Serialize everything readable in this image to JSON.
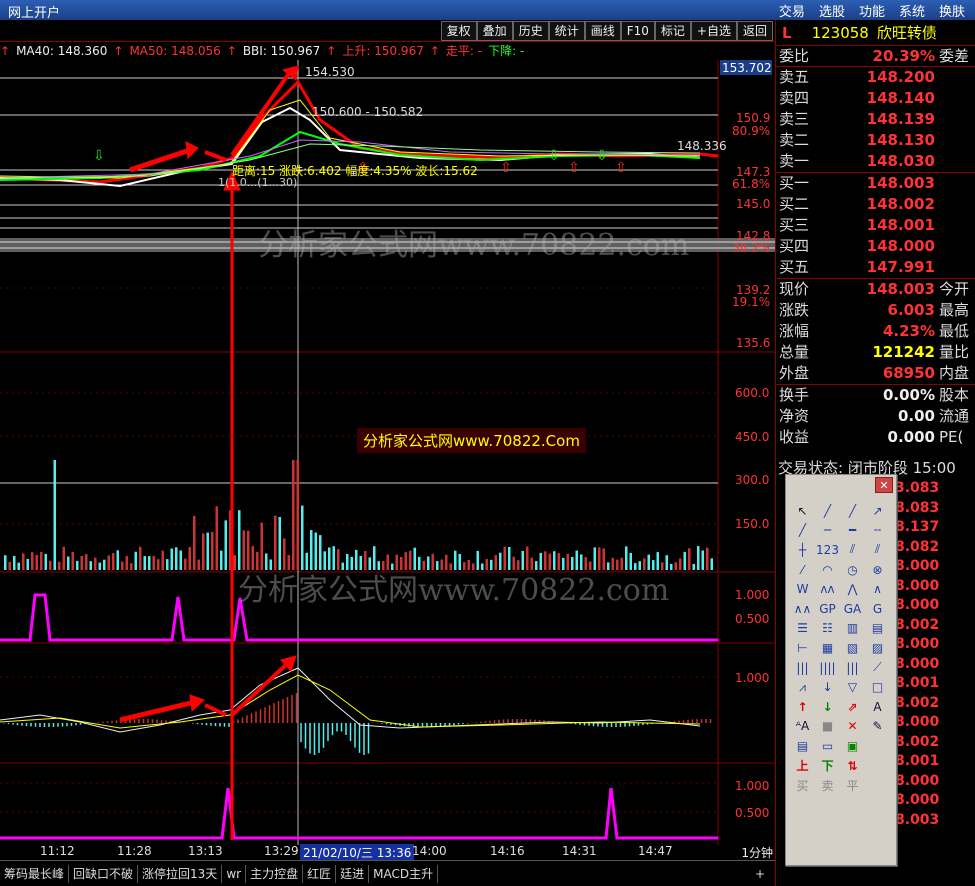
{
  "topbar": {
    "title": "网上开户",
    "menu": [
      "交易",
      "选股",
      "功能",
      "系统",
      "换肤"
    ]
  },
  "toolbar": {
    "buttons": [
      "复权",
      "叠加",
      "历史",
      "统计",
      "画线",
      "F10",
      "标记",
      "+自选",
      "返回"
    ]
  },
  "info": {
    "ma40": "MA40: 148.360",
    "ma50": "MA50: 148.056",
    "bbi": "BBI: 150.967",
    "up": "上升: 150.967",
    "flat": "走平: -",
    "down": "下降: -"
  },
  "price_axis": {
    "current_badge": "153.702",
    "labels": [
      {
        "text": "150.9"
      },
      {
        "text": "80.9%"
      },
      {
        "text": "147.3"
      },
      {
        "text": "61.8%"
      },
      {
        "text": "145.0"
      },
      {
        "text": "142.8"
      },
      {
        "text": "38.2%"
      },
      {
        "text": "139.2"
      },
      {
        "text": "19.1%"
      },
      {
        "text": "135.6"
      }
    ],
    "volume_labels": [
      "600.0",
      "450.0",
      "300.0",
      "150.0"
    ],
    "ind1_labels": [
      "1.000",
      "0.500"
    ],
    "ind2_labels": [
      "1.000"
    ],
    "ind3_labels": [
      "1.000",
      "0.500"
    ]
  },
  "annotations": {
    "high": "154.530",
    "range": "150.600 - 150.582",
    "last": "148.336",
    "measure": "距离:15 涨跌:6.402 幅度:4.35% 波长:15.62",
    "low_label": "1(1.0...(1...30)"
  },
  "watermarks": {
    "badge": "分析家公式网www.70822.Com",
    "big": "分析家公式网www.70822.com"
  },
  "quote": {
    "indicator": "L",
    "code": "123058",
    "name": "欣旺转债",
    "weibi": {
      "k": "委比",
      "v": "20.39%",
      "x": "委差"
    },
    "asks": [
      {
        "k": "卖五",
        "v": "148.200"
      },
      {
        "k": "卖四",
        "v": "148.140"
      },
      {
        "k": "卖三",
        "v": "148.139"
      },
      {
        "k": "卖二",
        "v": "148.130"
      },
      {
        "k": "卖一",
        "v": "148.030"
      }
    ],
    "bids": [
      {
        "k": "买一",
        "v": "148.003"
      },
      {
        "k": "买二",
        "v": "148.002"
      },
      {
        "k": "买三",
        "v": "148.001"
      },
      {
        "k": "买四",
        "v": "148.000"
      },
      {
        "k": "买五",
        "v": "147.991"
      }
    ],
    "stats": [
      {
        "k": "现价",
        "v": "148.003",
        "x": "今开"
      },
      {
        "k": "涨跌",
        "v": "6.003",
        "x": "最高"
      },
      {
        "k": "涨幅",
        "v": "4.23%",
        "x": "最低"
      },
      {
        "k": "总量",
        "v": "121242",
        "x": "量比"
      },
      {
        "k": "外盘",
        "v": "68950",
        "x": "内盘"
      }
    ],
    "stats2": [
      {
        "k": "换手",
        "v": "0.00%",
        "x": "股本"
      },
      {
        "k": "净资",
        "v": "0.00",
        "x": "流通"
      },
      {
        "k": "收益",
        "v": "0.000",
        "x": "PE("
      }
    ],
    "status": "交易状态: 闭市阶段 15:00"
  },
  "extra_values": [
    "3.083",
    "8.083",
    "8.137",
    "8.082",
    "8.000",
    "8.000",
    "8.000",
    "8.002",
    "8.000",
    "8.000",
    "8.001",
    "8.002",
    "8.000",
    "8.002",
    "8.001",
    "8.000",
    "8.000",
    "8.003"
  ],
  "palette": {
    "cells": [
      {
        "g": "↖",
        "c": ""
      },
      {
        "g": "╱",
        "c": "blue"
      },
      {
        "g": "╱",
        "c": "blue"
      },
      {
        "g": "↗",
        "c": "blue"
      },
      {
        "g": "╱",
        "c": "blue"
      },
      {
        "g": "─",
        "c": "blue"
      },
      {
        "g": "━",
        "c": "blue"
      },
      {
        "g": "╌",
        "c": "blue"
      },
      {
        "g": "┼",
        "c": "blue"
      },
      {
        "g": "123",
        "c": "blue"
      },
      {
        "g": "⫽",
        "c": "blue"
      },
      {
        "g": "⫽",
        "c": "blue"
      },
      {
        "g": "⁄",
        "c": "blue"
      },
      {
        "g": "◠",
        "c": "blue"
      },
      {
        "g": "◷",
        "c": "blue"
      },
      {
        "g": "⊗",
        "c": "blue"
      },
      {
        "g": "W",
        "c": "blue"
      },
      {
        "g": "ʌʌ",
        "c": "blue"
      },
      {
        "g": "⋀",
        "c": "blue"
      },
      {
        "g": "∧",
        "c": "blue"
      },
      {
        "g": "∧∧",
        "c": "blue"
      },
      {
        "g": "GP",
        "c": "blue"
      },
      {
        "g": "GA",
        "c": "blue"
      },
      {
        "g": "G",
        "c": "blue"
      },
      {
        "g": "☰",
        "c": "blue"
      },
      {
        "g": "☷",
        "c": "blue"
      },
      {
        "g": "▥",
        "c": "blue"
      },
      {
        "g": "▤",
        "c": "blue"
      },
      {
        "g": "⊢",
        "c": "blue"
      },
      {
        "g": "▦",
        "c": "blue"
      },
      {
        "g": "▧",
        "c": "blue"
      },
      {
        "g": "▨",
        "c": "blue"
      },
      {
        "g": "|||",
        "c": "blue"
      },
      {
        "g": "||||",
        "c": "blue"
      },
      {
        "g": "|||",
        "c": "blue"
      },
      {
        "g": "⟋",
        "c": "blue"
      },
      {
        "g": "⩘",
        "c": "blue"
      },
      {
        "g": "↓",
        "c": "blue"
      },
      {
        "g": "▽",
        "c": "blue"
      },
      {
        "g": "□",
        "c": "blue"
      },
      {
        "g": "↑",
        "c": "red"
      },
      {
        "g": "↓",
        "c": "green"
      },
      {
        "g": "⇗",
        "c": "red"
      },
      {
        "g": "A",
        "c": ""
      },
      {
        "g": "ᴬA",
        "c": ""
      },
      {
        "g": "■",
        "c": "gray"
      },
      {
        "g": "✕",
        "c": "red"
      },
      {
        "g": "✎",
        "c": ""
      },
      {
        "g": "▤",
        "c": "blue"
      },
      {
        "g": "▭",
        "c": "blue"
      },
      {
        "g": "▣",
        "c": "green"
      },
      {
        "g": "",
        "c": ""
      },
      {
        "g": "上",
        "c": "red"
      },
      {
        "g": "下",
        "c": "green"
      },
      {
        "g": "⇅",
        "c": "red"
      },
      {
        "g": "",
        "c": ""
      },
      {
        "g": "买",
        "c": "gray"
      },
      {
        "g": "卖",
        "c": "gray"
      },
      {
        "g": "平",
        "c": "gray"
      },
      {
        "g": "",
        "c": ""
      }
    ]
  },
  "time_axis": {
    "ticks": [
      {
        "text": "11:12"
      },
      {
        "text": "11:28"
      },
      {
        "text": "13:13"
      },
      {
        "text": "13:29"
      },
      {
        "text": "14:00"
      },
      {
        "text": "14:16"
      },
      {
        "text": "14:31"
      },
      {
        "text": "14:47"
      }
    ],
    "highlight": "21/02/10/三 13:36",
    "period": "1分钟"
  },
  "tabs": [
    "筹码最长峰",
    "回缺口不破",
    "涨停拉回13天",
    "wr",
    "主力控盘",
    "红匠",
    "廷进",
    "MACD主升"
  ],
  "tabs_plus": "+",
  "colors": {
    "up": "#ff3333",
    "down": "#40e0e8",
    "accent": "#ffff00",
    "magenta": "#ff00ff",
    "panel_border": "#880000"
  }
}
